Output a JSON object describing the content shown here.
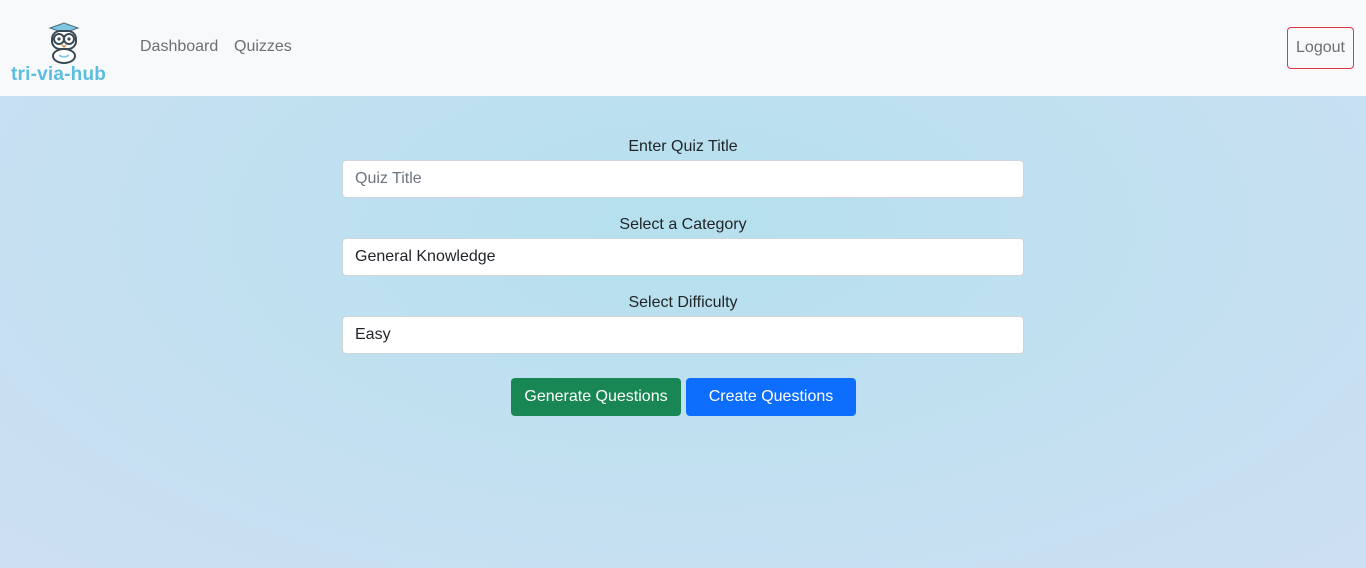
{
  "nav": {
    "brand": "tri-via-hub",
    "links": [
      "Dashboard",
      "Quizzes"
    ],
    "logout": "Logout"
  },
  "form": {
    "title_label": "Enter Quiz Title",
    "title_placeholder": "Quiz Title",
    "title_value": "",
    "category_label": "Select a Category",
    "category_value": "General Knowledge",
    "difficulty_label": "Select Difficulty",
    "difficulty_value": "Easy",
    "generate_button": "Generate Questions",
    "create_button": "Create Questions"
  },
  "colors": {
    "brand_text": "#5bbde0",
    "success": "#198754",
    "primary": "#0d6efd",
    "danger": "#dc3545"
  }
}
